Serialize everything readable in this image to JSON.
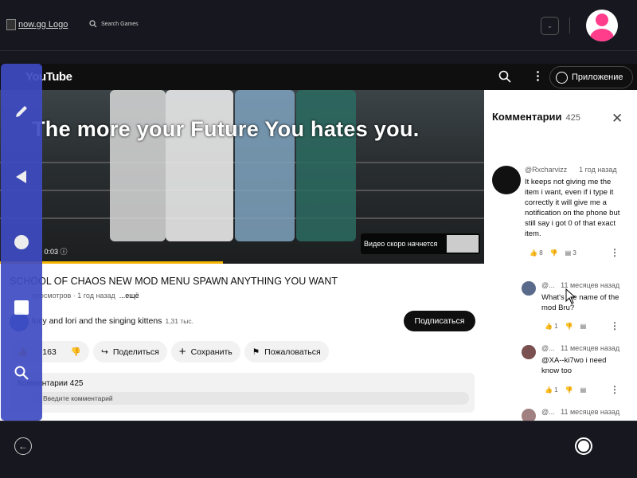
{
  "nowgg": {
    "logo_alt": "now.gg Logo",
    "search_label": "Search Games"
  },
  "youtube": {
    "logo": "YouTube",
    "app_button": "Приложение",
    "video": {
      "overlay_title": "The more your Future You hates you.",
      "time": "0:03",
      "up_next": "Видео скоро начнется",
      "progress": 0.46
    },
    "title": "SCHOOL OF CHAOS NEW MOD MENU SPAWN ANYTHING YOU WANT",
    "meta": {
      "views": "просмотров",
      "age": "1 год назад",
      "more": "...ещё"
    },
    "channel": {
      "name": "lucy and lori and the singing kittens",
      "subs": "1,31 тыс."
    },
    "subscribe": "Подписаться",
    "actions": {
      "likes": "163",
      "share": "Поделиться",
      "save": "Сохранить",
      "report": "Пожаловаться"
    },
    "comments_box": {
      "title": "Комментарии 425",
      "placeholder": "Введите комментарий"
    }
  },
  "comments_panel": {
    "title": "Комментарии",
    "count": "425",
    "items": [
      {
        "author": "@Rxcharvizz",
        "age": "1 год назад",
        "text": "It keeps not giving me the item i want, even if i type it correctly it will give me a notification on the phone but still say i got 0 of that exact item.",
        "likes": "8",
        "replies": "3"
      },
      {
        "author": "@...",
        "age": "11 месяцев назад",
        "text": "What's the name of the mod Bru?",
        "likes": "1"
      },
      {
        "author": "@...",
        "age": "11 месяцев назад",
        "text": "@XA--ki7wo  i need know too",
        "likes": "1"
      },
      {
        "author": "@...",
        "age": "11 месяцев назад"
      }
    ]
  }
}
